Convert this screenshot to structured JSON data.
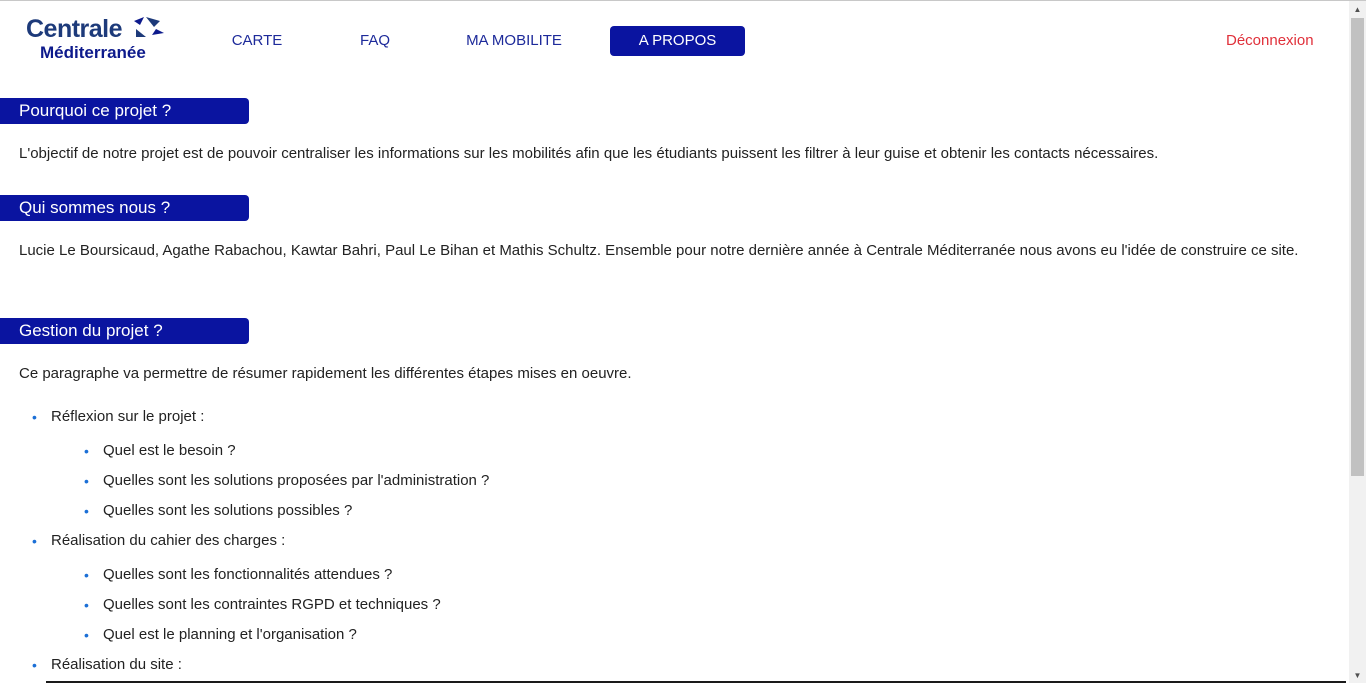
{
  "header": {
    "logo_line1": "Centrale",
    "logo_line2": "Méditerranée",
    "nav": [
      {
        "label": "CARTE"
      },
      {
        "label": "FAQ"
      },
      {
        "label": "MA MOBILITE"
      },
      {
        "label": "A PROPOS",
        "active": true
      }
    ],
    "logout": "Déconnexion"
  },
  "sections": [
    {
      "title": "Pourquoi ce projet ?",
      "text": "L'objectif de notre projet est de pouvoir centraliser les informations sur les mobilités afin que les étudiants puissent les filtrer à leur guise et obtenir les contacts nécessaires."
    },
    {
      "title": "Qui sommes nous ?",
      "text": "Lucie Le Boursicaud, Agathe Rabachou, Kawtar Bahri, Paul Le Bihan et Mathis Schultz. Ensemble pour notre dernière année à Centrale Méditerranée nous avons eu l'idée de construire ce site."
    },
    {
      "title": "Gestion du projet ?",
      "text": "Ce paragraphe va permettre de résumer rapidement les différentes étapes mises en oeuvre.",
      "steps": [
        {
          "label": "Réflexion sur le projet :",
          "items": [
            "Quel est le besoin ?",
            "Quelles sont les solutions proposées par l'administration ?",
            "Quelles sont les solutions possibles ?"
          ]
        },
        {
          "label": "Réalisation du cahier des charges :",
          "items": [
            "Quelles sont les fonctionnalités attendues ?",
            "Quelles sont les contraintes RGPD et techniques ?",
            "Quel est le planning et l'organisation ?"
          ]
        },
        {
          "label": "Réalisation du site :",
          "items": []
        }
      ]
    }
  ],
  "bullet": "•",
  "colors": {
    "brand_blue": "#0a14a0",
    "nav_text": "#1d2a9a",
    "logout_red": "#e0303a",
    "bullet_blue": "#1b6fd6"
  }
}
